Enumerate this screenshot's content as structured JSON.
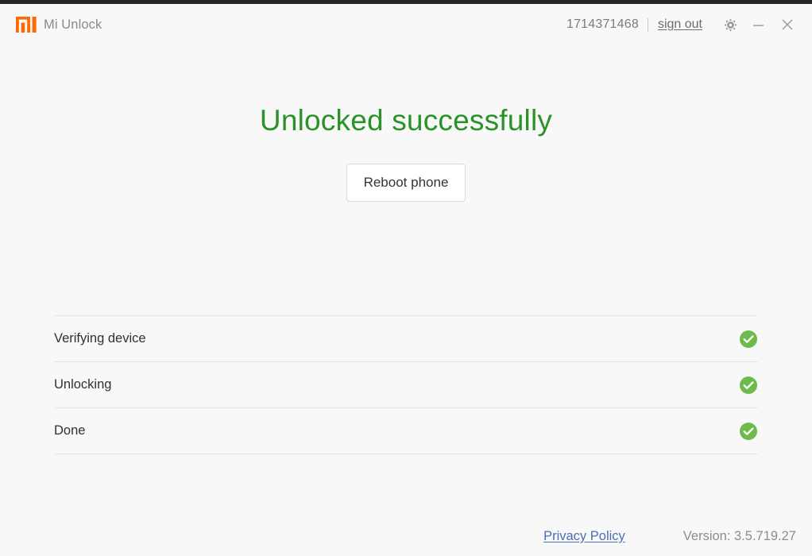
{
  "titlebar": {
    "logo_name": "mi-logo",
    "logo_color": "#ff6900",
    "app_title": "Mi Unlock",
    "account_id": "1714371468",
    "sign_out_label": "sign out",
    "settings_icon": "gear-icon",
    "minimize_icon": "minimize-icon",
    "close_icon": "close-icon"
  },
  "main": {
    "headline": "Unlocked successfully",
    "headline_color": "#2a9227",
    "reboot_button_label": "Reboot phone"
  },
  "steps": {
    "status_color": "#6cbb4b",
    "items": [
      {
        "label": "Verifying device",
        "status_icon": "check-circle-icon"
      },
      {
        "label": "Unlocking",
        "status_icon": "check-circle-icon"
      },
      {
        "label": "Done",
        "status_icon": "check-circle-icon"
      }
    ]
  },
  "footer": {
    "privacy_label": "Privacy Policy",
    "privacy_color": "#4a6fb5",
    "version_label": "Version: 3.5.719.27"
  }
}
